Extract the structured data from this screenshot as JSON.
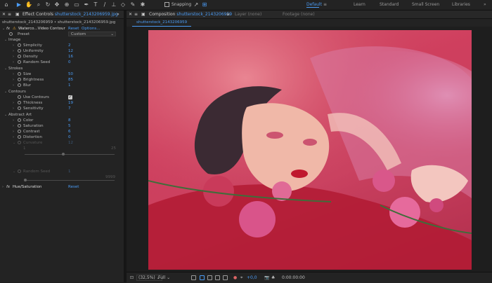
{
  "toolbar": {
    "snapping_label": "Snapping",
    "workspaces": [
      "Default",
      "Learn",
      "Standard",
      "Small Screen",
      "Libraries"
    ],
    "active_workspace": "Default"
  },
  "effect_controls": {
    "tab_label": "Effect Controls",
    "tab_file": "shutterstock_2143206959.jpg",
    "subtitle": "shutterstock_2143206959 • shutterstock_2143206959.jpg",
    "effect1": {
      "name": "Waterco...Video Contour",
      "reset": "Reset",
      "options": "Options..."
    },
    "preset": {
      "label": "Preset",
      "value": "Custom"
    },
    "groups": {
      "image": "Image",
      "strokes": "Strokes",
      "contours": "Contours",
      "abstract": "Abstract Art"
    },
    "params": {
      "simplicity": {
        "label": "Simplicity",
        "value": "2"
      },
      "uniformity": {
        "label": "Uniformity",
        "value": "12"
      },
      "density": {
        "label": "Density",
        "value": "16"
      },
      "random_seed": {
        "label": "Random Seed",
        "value": "0"
      },
      "size": {
        "label": "Size",
        "value": "50"
      },
      "brightness": {
        "label": "Brightness",
        "value": "85"
      },
      "blur": {
        "label": "Blur",
        "value": "1"
      },
      "use_contours": {
        "label": "Use Contours"
      },
      "thickness": {
        "label": "Thickness",
        "value": "19"
      },
      "sensitivity": {
        "label": "Sensitivity",
        "value": "7"
      },
      "color": {
        "label": "Color",
        "value": "8"
      },
      "saturation": {
        "label": "Saturation",
        "value": "5"
      },
      "contrast": {
        "label": "Contrast",
        "value": "6"
      },
      "distortion": {
        "label": "Distortion",
        "value": "0"
      },
      "curvature": {
        "label": "Curvature",
        "value": "12"
      },
      "curvature_max": "25",
      "random_seed2": {
        "label": "Random Seed",
        "value": "1"
      },
      "random_seed2_max": "9999"
    },
    "effect2": {
      "name": "Hue/Saturation",
      "reset": "Reset"
    }
  },
  "composition": {
    "tab_prefix": "Composition",
    "tab_name": "shutterstock_2143206959",
    "layer_label": "Layer (none)",
    "footage_label": "Footage (none)",
    "comp_tab": "shutterstock_2143206959"
  },
  "bottom_bar": {
    "zoom": "(32,5%)",
    "resolution": "Full",
    "exposure": "+0,0",
    "timecode": "0:00:00:00"
  }
}
